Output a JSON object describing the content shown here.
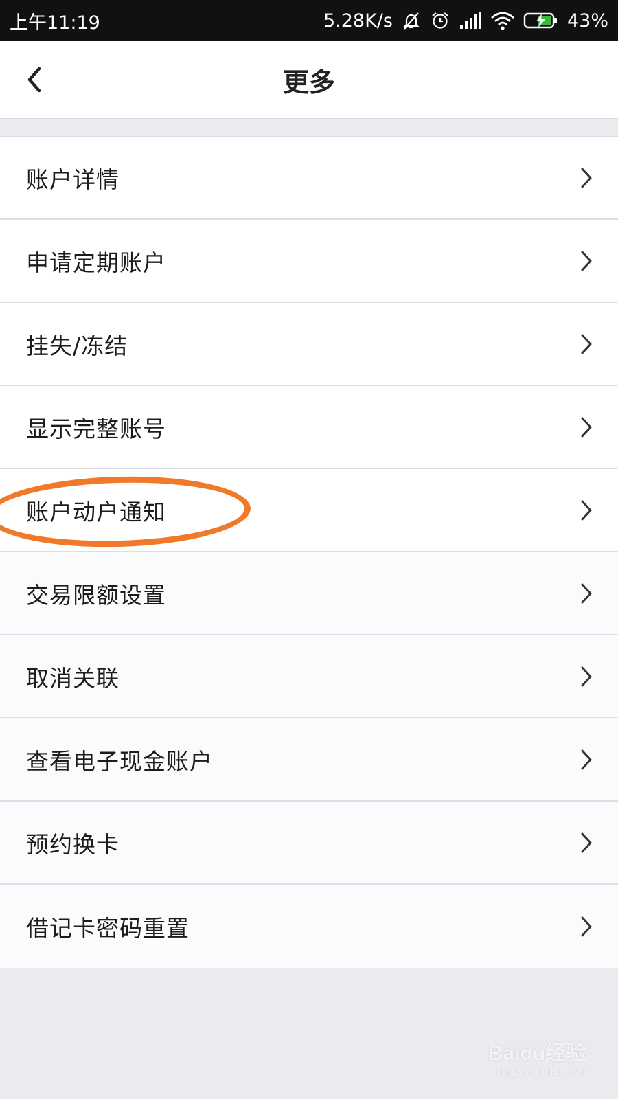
{
  "status_bar": {
    "time": "上午11:19",
    "network_speed": "5.28K/s",
    "battery": "43%",
    "icons": [
      "bell-muted-icon",
      "alarm-icon",
      "signal-icon",
      "wifi-icon",
      "battery-charging-icon"
    ]
  },
  "header": {
    "back_icon": "chevron-left-icon",
    "title": "更多"
  },
  "menu": {
    "items": [
      {
        "label": "账户详情"
      },
      {
        "label": "申请定期账户"
      },
      {
        "label": "挂失/冻结"
      },
      {
        "label": "显示完整账号"
      },
      {
        "label": "账户动户通知",
        "highlighted": true
      },
      {
        "label": "交易限额设置"
      },
      {
        "label": "取消关联"
      },
      {
        "label": "查看电子现金账户"
      },
      {
        "label": "预约换卡"
      },
      {
        "label": "借记卡密码重置"
      }
    ],
    "chevron_icon": "chevron-right-icon"
  },
  "colors": {
    "highlight": "#f07a2a",
    "background": "#e9ebef",
    "status_bar": "#111111",
    "battery_charge": "#3cba3c"
  },
  "watermark": {
    "logo": "Baidu经验",
    "url": "jingyan.baidu.com"
  }
}
